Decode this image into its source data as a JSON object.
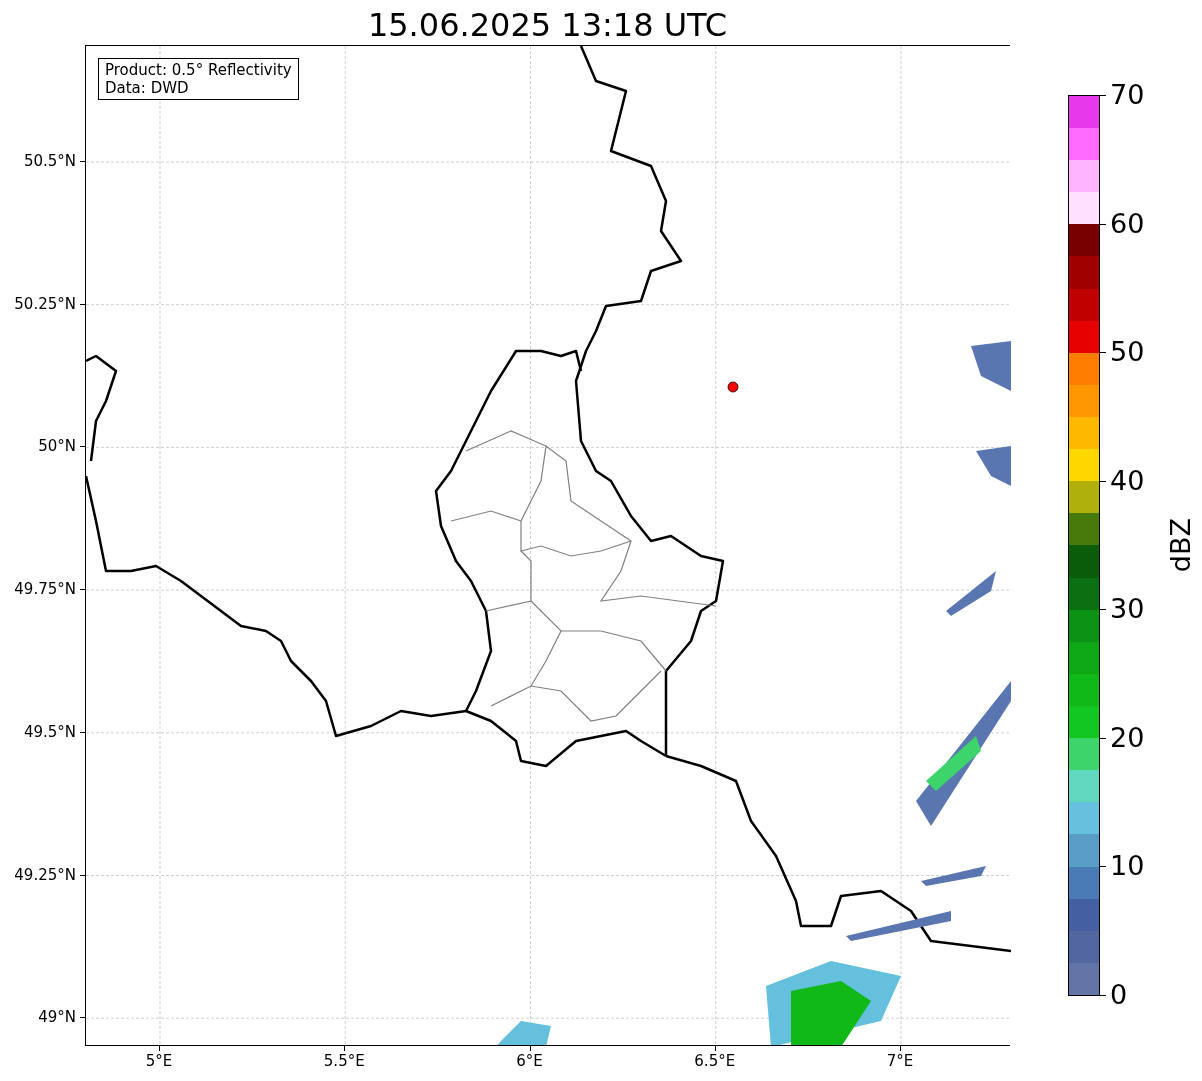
{
  "title": "15.06.2025 13:18 UTC",
  "map": {
    "info_lines": [
      "Product: 0.5° Reflectivity",
      "Data: DWD"
    ],
    "y_ticks": [
      "50.5°N",
      "50.25°N",
      "50°N",
      "49.75°N",
      "49.5°N",
      "49.25°N",
      "49°N"
    ],
    "x_ticks": [
      "5°E",
      "5.5°E",
      "6°E",
      "6.5°E",
      "7°E"
    ]
  },
  "colorbar": {
    "label": "dBZ",
    "ticks": [
      "70",
      "60",
      "50",
      "40",
      "30",
      "20",
      "10",
      "0"
    ],
    "segments": [
      {
        "color": "#6374a6"
      },
      {
        "color": "#5266a0"
      },
      {
        "color": "#4460a2"
      },
      {
        "color": "#4a7bb4"
      },
      {
        "color": "#5a9ec8"
      },
      {
        "color": "#64c0dc"
      },
      {
        "color": "#60d8c0"
      },
      {
        "color": "#3dd46c"
      },
      {
        "color": "#12c820"
      },
      {
        "color": "#10b818"
      },
      {
        "color": "#0ea816"
      },
      {
        "color": "#0c9214"
      },
      {
        "color": "#0b7012"
      },
      {
        "color": "#0a5c0a"
      },
      {
        "color": "#477a0a"
      },
      {
        "color": "#b0b00a"
      },
      {
        "color": "#ffd800"
      },
      {
        "color": "#ffb800"
      },
      {
        "color": "#ff9800"
      },
      {
        "color": "#ff7d00"
      },
      {
        "color": "#e60000"
      },
      {
        "color": "#c00000"
      },
      {
        "color": "#a00000"
      },
      {
        "color": "#780000"
      },
      {
        "color": "#ffe0ff"
      },
      {
        "color": "#ffb4ff"
      },
      {
        "color": "#ff6cff"
      },
      {
        "color": "#e838ec"
      }
    ]
  }
}
